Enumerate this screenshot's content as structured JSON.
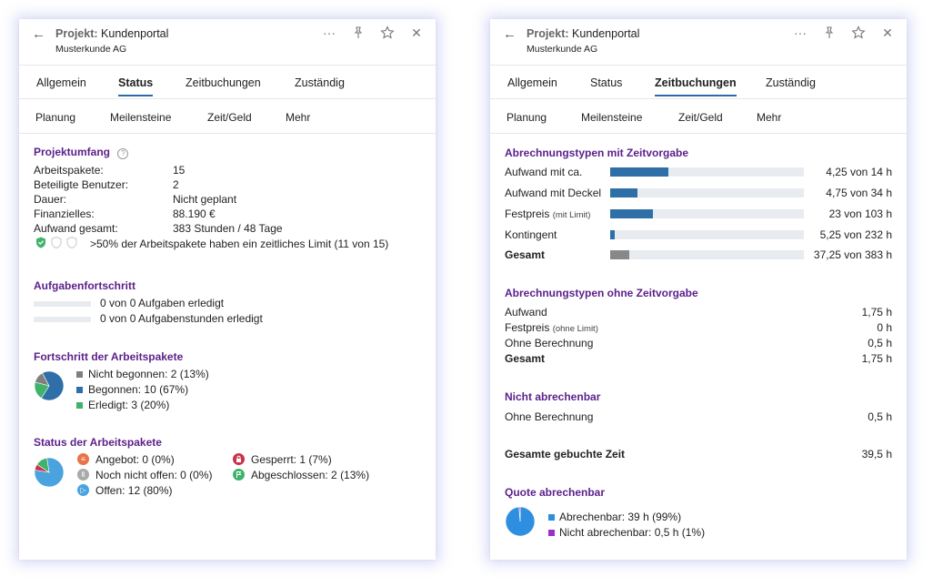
{
  "left": {
    "header": {
      "title_prefix": "Projekt:",
      "title": "Kundenportal",
      "subtitle": "Musterkunde AG"
    },
    "icons": [
      "back-arrow-icon",
      "more-icon",
      "pin-icon",
      "star-icon",
      "close-icon"
    ],
    "tabs": [
      {
        "label": "Allgemein",
        "active": false
      },
      {
        "label": "Status",
        "active": true
      },
      {
        "label": "Zeitbuchungen",
        "active": false
      },
      {
        "label": "Zuständig",
        "active": false
      }
    ],
    "subtabs": [
      "Planung",
      "Meilensteine",
      "Zeit/Geld",
      "Mehr"
    ],
    "projektumfang": {
      "title": "Projektumfang",
      "rows": [
        {
          "label": "Arbeitspakete:",
          "value": "15"
        },
        {
          "label": "Beteiligte Benutzer:",
          "value": "2"
        },
        {
          "label": "Dauer:",
          "value": "Nicht geplant"
        },
        {
          "label": "Finanzielles:",
          "value": "88.190 €"
        },
        {
          "label": "Aufwand gesamt:",
          "value": "383 Stunden / 48 Tage"
        }
      ],
      "limit_text": ">50% der Arbeitspakete haben ein zeitliches Limit (11 von 15)"
    },
    "aufgaben": {
      "title": "Aufgabenfortschritt",
      "rows": [
        {
          "text": "0 von 0 Aufgaben erledigt",
          "fraction": 0
        },
        {
          "text": "0 von 0 Aufgabenstunden erledigt",
          "fraction": 0
        }
      ]
    },
    "fortschritt": {
      "title": "Fortschritt der Arbeitspakete",
      "legend": [
        {
          "label": "Nicht begonnen: 2 (13%)",
          "color": "#7f7f7f"
        },
        {
          "label": "Begonnen: 10 (67%)",
          "color": "#2e6fa8"
        },
        {
          "label": "Erledigt: 3 (20%)",
          "color": "#3fb36b"
        }
      ]
    },
    "status": {
      "title": "Status der Arbeitspakete",
      "items": [
        {
          "label": "Angebot: 0 (0%)",
          "icon": "list-icon",
          "color": "#e8754a",
          "glyph": "≡"
        },
        {
          "label": "Noch nicht offen: 0 (0%)",
          "icon": "pause-icon",
          "color": "#a9a9a9",
          "glyph": "Ⅱ"
        },
        {
          "label": "Offen: 12 (80%)",
          "icon": "play-icon",
          "color": "#4aa3df",
          "glyph": "▷"
        },
        {
          "label": "Gesperrt: 1 (7%)",
          "icon": "lock-icon",
          "color": "#c9344a",
          "glyph": "🔒"
        },
        {
          "label": "Abgeschlossen: 2 (13%)",
          "icon": "flag-icon",
          "color": "#3fb36b",
          "glyph": "⚑"
        }
      ]
    }
  },
  "right": {
    "header": {
      "title_prefix": "Projekt:",
      "title": "Kundenportal",
      "subtitle": "Musterkunde AG"
    },
    "tabs": [
      {
        "label": "Allgemein",
        "active": false
      },
      {
        "label": "Status",
        "active": false
      },
      {
        "label": "Zeitbuchungen",
        "active": true
      },
      {
        "label": "Zuständig",
        "active": false
      }
    ],
    "subtabs": [
      "Planung",
      "Meilensteine",
      "Zeit/Geld",
      "Mehr"
    ],
    "mit_zeitvorgabe": {
      "title": "Abrechnungstypen mit Zeitvorgabe",
      "rows": [
        {
          "label": "Aufwand mit ca.",
          "note": "",
          "value": "4,25 von 14 h",
          "fraction": 0.3,
          "bold": false
        },
        {
          "label": "Aufwand mit Deckel",
          "note": "",
          "value": "4,75 von 34 h",
          "fraction": 0.14,
          "bold": false
        },
        {
          "label": "Festpreis",
          "note": "(mit Limit)",
          "value": "23 von 103 h",
          "fraction": 0.22,
          "bold": false
        },
        {
          "label": "Kontingent",
          "note": "",
          "value": "5,25 von 232 h",
          "fraction": 0.023,
          "bold": false
        },
        {
          "label": "Gesamt",
          "note": "",
          "value": "37,25 von 383 h",
          "fraction": 0.097,
          "bold": true
        }
      ]
    },
    "ohne_zeitvorgabe": {
      "title": "Abrechnungstypen ohne Zeitvorgabe",
      "rows": [
        {
          "label": "Aufwand",
          "note": "",
          "value": "1,75 h",
          "bold": false
        },
        {
          "label": "Festpreis",
          "note": "(ohne Limit)",
          "value": "0 h",
          "bold": false
        },
        {
          "label": "Ohne Berechnung",
          "note": "",
          "value": "0,5 h",
          "bold": false
        },
        {
          "label": "Gesamt",
          "note": "",
          "value": "1,75 h",
          "bold": true
        }
      ]
    },
    "nicht_abrechenbar": {
      "title": "Nicht abrechenbar",
      "label": "Ohne Berechnung",
      "value": "0,5 h"
    },
    "gesamt_zeit": {
      "label": "Gesamte gebuchte Zeit",
      "value": "39,5 h"
    },
    "quote": {
      "title": "Quote abrechenbar",
      "legend": [
        {
          "label": "Abrechenbar: 39 h (99%)",
          "color": "#2e8fe0"
        },
        {
          "label": "Nicht abrechenbar: 0,5 h (1%)",
          "color": "#9b30c9"
        }
      ]
    }
  },
  "chart_data": [
    {
      "type": "pie",
      "categories": [
        "Nicht begonnen",
        "Begonnen",
        "Erledigt"
      ],
      "values": [
        2,
        10,
        3
      ],
      "colors": [
        "#7f7f7f",
        "#2e6fa8",
        "#3fb36b"
      ]
    },
    {
      "type": "pie",
      "categories": [
        "Angebot",
        "Noch nicht offen",
        "Offen",
        "Gesperrt",
        "Abgeschlossen"
      ],
      "values": [
        0,
        0,
        12,
        1,
        2
      ],
      "colors": [
        "#e8754a",
        "#a9a9a9",
        "#4aa3df",
        "#c9344a",
        "#3fb36b"
      ]
    },
    {
      "type": "pie",
      "categories": [
        "Abrechenbar",
        "Nicht abrechenbar"
      ],
      "values": [
        39,
        0.5
      ],
      "colors": [
        "#2e8fe0",
        "#9b30c9"
      ]
    }
  ]
}
